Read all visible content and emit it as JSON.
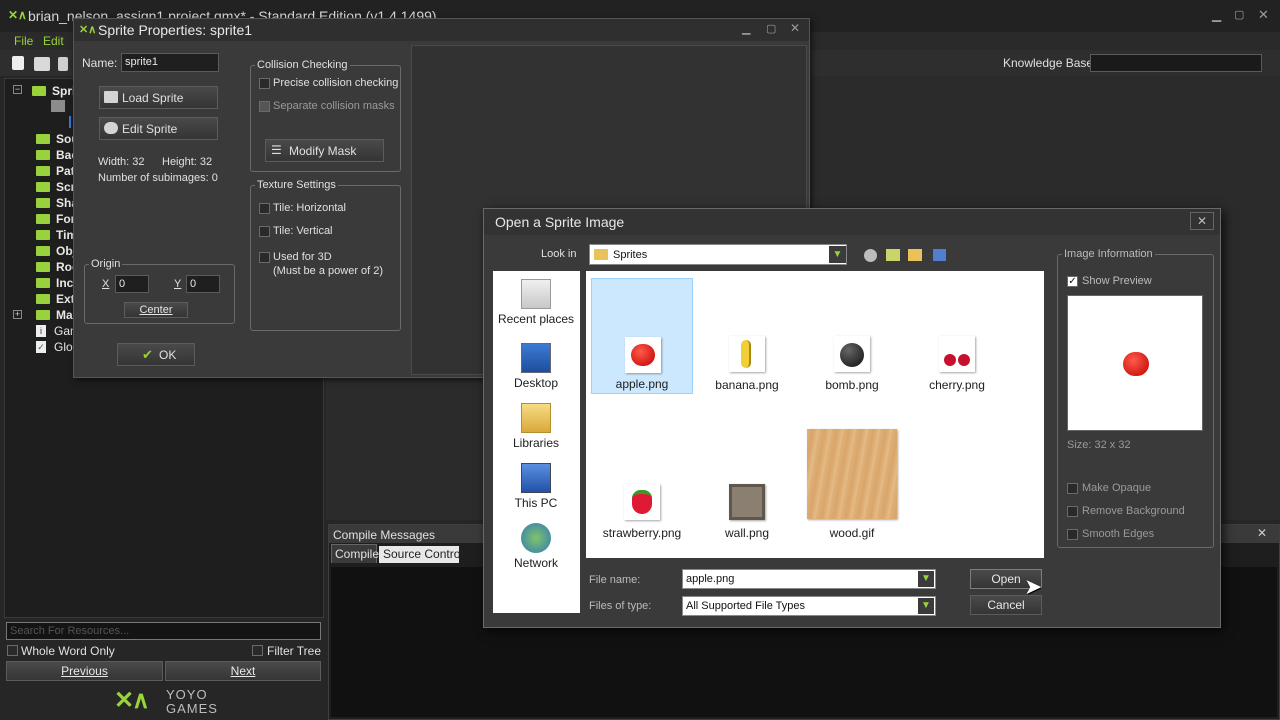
{
  "main_window": {
    "title": "brian_nelson_assign1.project.gmx* - Standard Edition (v1.4.1499)",
    "menu": [
      "File",
      "Edit"
    ],
    "knowledge_base_label": "Knowledge Base:",
    "knowledge_base_value": ""
  },
  "resource_tree": {
    "items": [
      {
        "label": "Spri",
        "expanded": true
      },
      {
        "label": "Sou"
      },
      {
        "label": "Bac"
      },
      {
        "label": "Pat"
      },
      {
        "label": "Scr"
      },
      {
        "label": "Sha"
      },
      {
        "label": "Fon"
      },
      {
        "label": "Tim"
      },
      {
        "label": "Obj"
      },
      {
        "label": "Roo"
      },
      {
        "label": "Incl"
      },
      {
        "label": "Exte"
      },
      {
        "label": "Mac"
      },
      {
        "label": "Gam"
      },
      {
        "label": "Glob"
      }
    ],
    "search_placeholder": "Search For Resources...",
    "whole_word_label": "Whole Word Only",
    "filter_tree_label": "Filter Tree",
    "previous_label": "Previous",
    "next_label": "Next"
  },
  "logo": {
    "line1": "YOYO",
    "line2": "GAMES"
  },
  "compile_panel": {
    "title": "Compile Messages",
    "tabs": [
      "Compile",
      "Source Control"
    ]
  },
  "sprite_props": {
    "title": "Sprite Properties: sprite1",
    "name_label": "Name:",
    "name_value": "sprite1",
    "load_sprite": "Load Sprite",
    "edit_sprite": "Edit Sprite",
    "width_text": "Width: 32",
    "height_text": "Height: 32",
    "subimages_text": "Number of subimages: 0",
    "origin_label": "Origin",
    "x_label": "X",
    "x_value": "0",
    "y_label": "Y",
    "y_value": "0",
    "center_label": "Center",
    "ok_label": "OK",
    "collision_title": "Collision Checking",
    "precise_label": "Precise collision checking",
    "separate_label": "Separate collision masks",
    "modify_mask": "Modify Mask",
    "texture_title": "Texture Settings",
    "tile_h": "Tile: Horizontal",
    "tile_v": "Tile: Vertical",
    "used_3d": "Used for 3D",
    "used_3d_note": "(Must be a power of 2)"
  },
  "open_dialog": {
    "title": "Open a Sprite Image",
    "look_in_label": "Look in",
    "look_in_value": "Sprites",
    "places": [
      "Recent places",
      "Desktop",
      "Libraries",
      "This PC",
      "Network"
    ],
    "files": [
      {
        "name": "apple.png",
        "icon": "apple-icon",
        "selected": true
      },
      {
        "name": "banana.png",
        "icon": "banana-icon"
      },
      {
        "name": "bomb.png",
        "icon": "bomb-icon"
      },
      {
        "name": "cherry.png",
        "icon": "cherry-icon"
      },
      {
        "name": "strawberry.png",
        "icon": "strawberry-icon"
      },
      {
        "name": "wall.png",
        "icon": "wall-icon"
      },
      {
        "name": "wood.gif",
        "icon": "wood-icon"
      }
    ],
    "file_name_label": "File name:",
    "file_name_value": "apple.png",
    "file_type_label": "Files of type:",
    "file_type_value": "All Supported File Types",
    "open_label": "Open",
    "cancel_label": "Cancel",
    "image_info_title": "Image Information",
    "show_preview": "Show Preview",
    "size_text": "Size: 32 x 32",
    "make_opaque": "Make Opaque",
    "remove_background": "Remove Background",
    "smooth_edges": "Smooth Edges"
  },
  "colors": {
    "accent_green": "#9ad23c",
    "selection_blue": "#cce8ff",
    "dialog_bg": "#3a3a3a"
  }
}
